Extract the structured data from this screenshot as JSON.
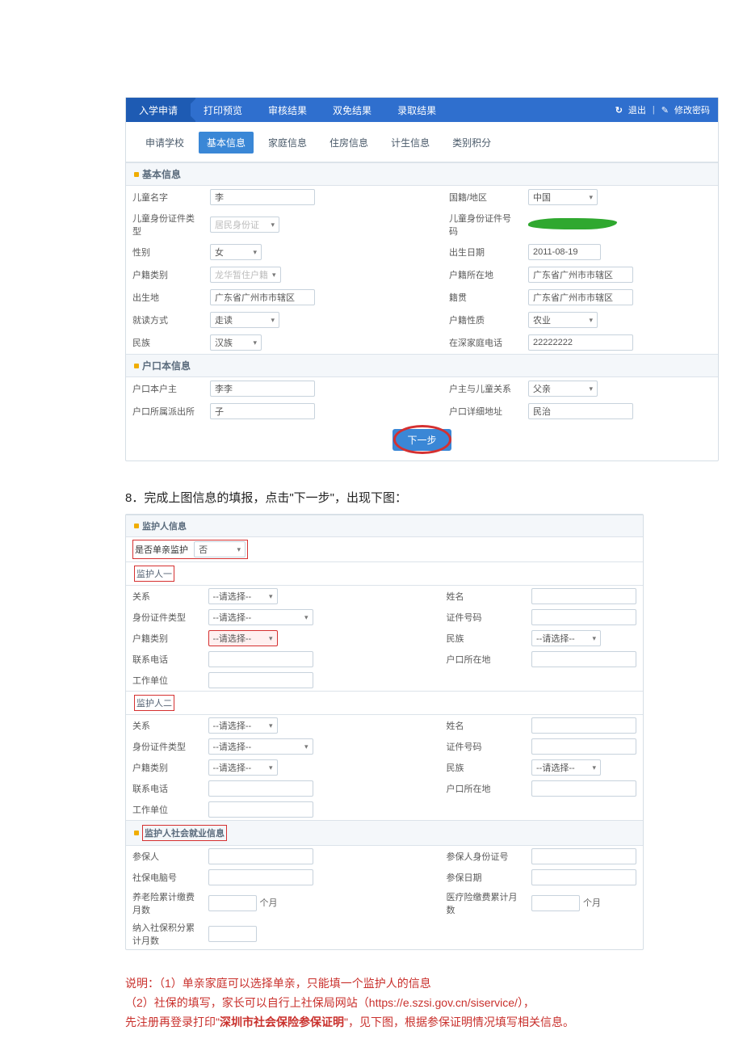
{
  "nav": {
    "items": [
      "入学申请",
      "打印预览",
      "审核结果",
      "双免结果",
      "录取结果"
    ],
    "logout": "退出",
    "pwd": "修改密码"
  },
  "tabs": [
    "申请学校",
    "基本信息",
    "家庭信息",
    "住房信息",
    "计生信息",
    "类别积分"
  ],
  "section1": {
    "title": "基本信息",
    "rows": {
      "child_name_l": "儿童名字",
      "child_name_v": "李",
      "nationality_l": "国籍/地区",
      "nationality_v": "中国",
      "idtype_l": "儿童身份证件类型",
      "idtype_v": "居民身份证",
      "idno_l": "儿童身份证件号码",
      "gender_l": "性别",
      "gender_v": "女",
      "dob_l": "出生日期",
      "dob_v": "2011-08-19",
      "hukou_type_l": "户籍类别",
      "hukou_type_v": "龙华暂住户籍",
      "hukou_loc_l": "户籍所在地",
      "hukou_loc_v": "广东省广州市市辖区",
      "birth_place_l": "出生地",
      "birth_place_v": "广东省广州市市辖区",
      "native_l": "籍贯",
      "native_v": "广东省广州市市辖区",
      "study_mode_l": "就读方式",
      "study_mode_v": "走读",
      "hukou_nature_l": "户籍性质",
      "hukou_nature_v": "农业",
      "ethnic_l": "民族",
      "ethnic_v": "汉族",
      "home_phone_l": "在深家庭电话",
      "home_phone_v": "22222222"
    }
  },
  "section2": {
    "title": "户口本信息",
    "rows": {
      "head_l": "户口本户主",
      "head_v": "李李",
      "relation_l": "户主与儿童关系",
      "relation_v": "父亲",
      "station_l": "户口所属派出所",
      "station_v": "子",
      "addr_l": "户口详细地址",
      "addr_v": "民治"
    },
    "next_btn": "下一步"
  },
  "para8": "8．完成上图信息的填报，点击\"下一步\"，出现下图：",
  "g": {
    "title": "监护人信息",
    "single_l": "是否单亲监护",
    "single_v": "否",
    "sub1": "监护人一",
    "sub2": "监护人二",
    "rel_l": "关系",
    "rel_ph": "--请选择--",
    "name_l": "姓名",
    "idtype_l": "身份证件类型",
    "idtype_ph": "--请选择--",
    "idno_l": "证件号码",
    "hukou_l": "户籍类别",
    "hukou_ph": "--请选择--",
    "ethnic_l": "民族",
    "ethnic_ph": "--请选择--",
    "phone_l": "联系电话",
    "hkloc_l": "户口所在地",
    "work_l": "工作单位"
  },
  "ss": {
    "title": "监护人社会就业信息",
    "insured_l": "参保人",
    "insured_id_l": "参保人身份证号",
    "sscomp_l": "社保电脑号",
    "ssdate_l": "参保日期",
    "pension_l": "养老险累计缴费月数",
    "med_l": "医疗险缴费累计月数",
    "points_l": "纳入社保积分累计月数",
    "unit": "个月"
  },
  "notes": {
    "l1a": "说明：（1）单亲家庭可以选择单亲，只能填一个监护人的信息",
    "l2a": "（2）社保的填写，家长可以自行上社保局网站（",
    "url": "https://e.szsi.gov.cn/siservice/",
    "l2b": "），",
    "l3a": "先注册再登录打印\"",
    "bold": "深圳市社会保险参保证明",
    "l3b": "\"，见下图，根据参保证明情况填写相关信息。"
  }
}
